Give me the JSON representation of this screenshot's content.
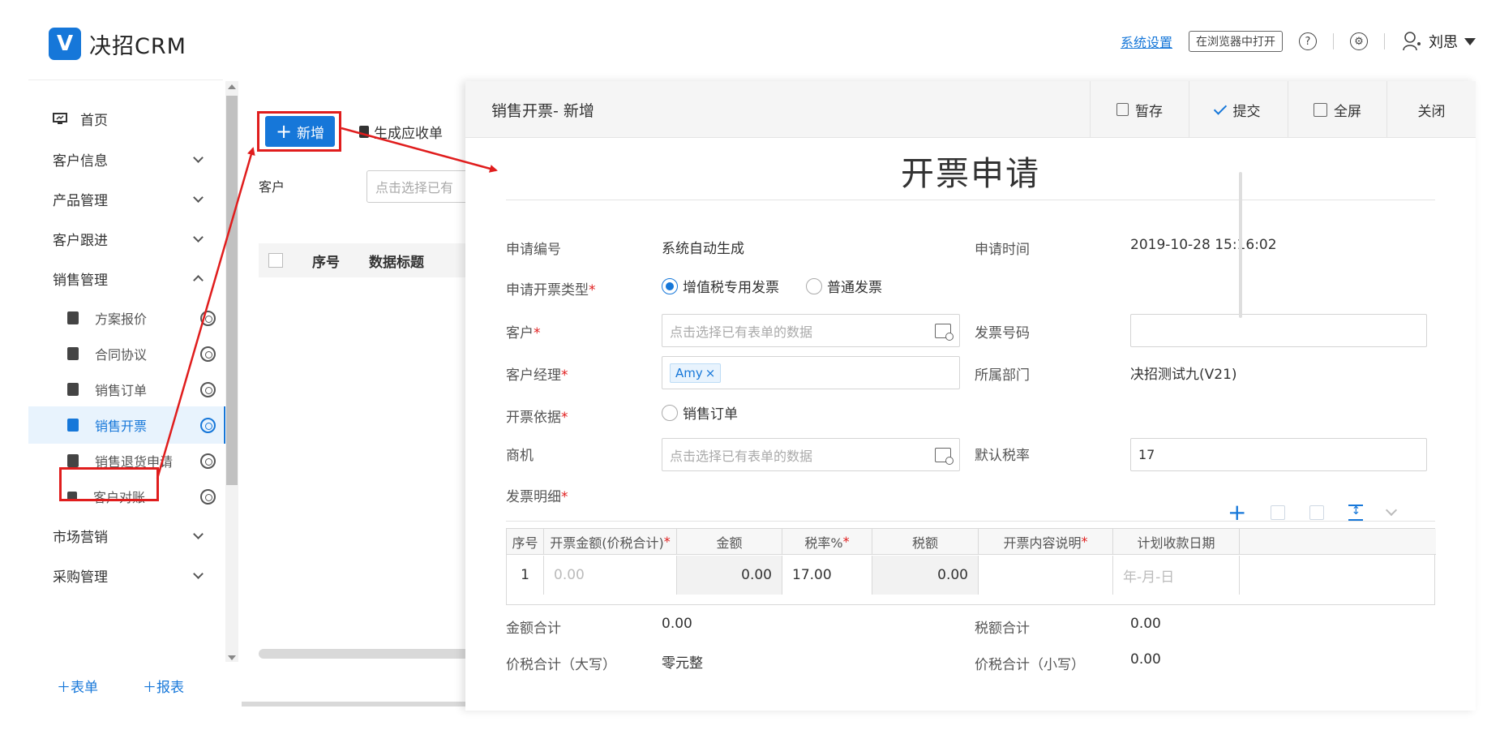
{
  "app": {
    "logo_text": "决招CRM",
    "logo_badge": "V",
    "accent": "#1677d9",
    "annotation_color": "#e01d1d"
  },
  "header": {
    "settings_link": "系统设置",
    "open_in_browser": "在浏览器中打开",
    "help_icon": "question-circle-icon",
    "settings_icon": "gear-icon",
    "user_name": "刘思"
  },
  "sidebar": {
    "items": [
      {
        "label": "首页",
        "icon": "home-icon"
      },
      {
        "label": "客户信息"
      },
      {
        "label": "产品管理"
      },
      {
        "label": "客户跟进"
      },
      {
        "label": "销售管理"
      }
    ],
    "sub_items": [
      {
        "label": "方案报价"
      },
      {
        "label": "合同协议"
      },
      {
        "label": "销售订单"
      },
      {
        "label": "销售开票"
      },
      {
        "label": "销售退货申请"
      },
      {
        "label": "客户对账"
      }
    ],
    "items_after": [
      {
        "label": "市场营销"
      },
      {
        "label": "采购管理"
      }
    ],
    "footer": {
      "add_form": "表单",
      "add_report": "报表"
    }
  },
  "list_page": {
    "add_button": "新增",
    "generate_button": "生成应收单",
    "customer_label": "客户",
    "customer_placeholder": "点击选择已有",
    "col_index": "序号",
    "col_title": "数据标题"
  },
  "modal": {
    "title": "销售开票- 新增",
    "actions": {
      "save_draft": "暂存",
      "submit": "提交",
      "fullscreen": "全屏",
      "close": "关闭"
    },
    "form_title": "开票申请",
    "fields": {
      "apply_no_label": "申请编号",
      "apply_no_value": "系统自动生成",
      "apply_time_label": "申请时间",
      "apply_time_value": "2019-10-28 15:16:02",
      "invoice_type_label": "申请开票类型",
      "invoice_type_options": [
        "增值税专用发票",
        "普通发票"
      ],
      "invoice_type_selected": "增值税专用发票",
      "customer_label": "客户",
      "customer_placeholder": "点击选择已有表单的数据",
      "invoice_no_label": "发票号码",
      "invoice_no_value": "",
      "manager_label": "客户经理",
      "manager_tag": "Amy",
      "department_label": "所属部门",
      "department_value": "决招测试九(V21)",
      "basis_label": "开票依据",
      "basis_option": "销售订单",
      "opportunity_label": "商机",
      "opportunity_placeholder": "点击选择已有表单的数据",
      "tax_rate_label": "默认税率",
      "tax_rate_value": "17"
    },
    "detail": {
      "label": "发票明细",
      "columns": [
        "序号",
        "开票金额(价税合计)",
        "金额",
        "税率%",
        "税额",
        "开票内容说明",
        "计划收款日期"
      ],
      "required_columns": [
        "开票金额(价税合计)",
        "税率%",
        "开票内容说明"
      ],
      "rows": [
        {
          "index": "1",
          "invoice_amount": "0.00",
          "amount": "0.00",
          "tax_rate": "17.00",
          "tax": "0.00",
          "description": "",
          "date": "年-月-日"
        }
      ]
    },
    "totals": {
      "amount_total_label": "金额合计",
      "amount_total_value": "0.00",
      "tax_total_label": "税额合计",
      "tax_total_value": "0.00",
      "grand_upper_label": "价税合计（大写）",
      "grand_upper_value": "零元整",
      "grand_lower_label": "价税合计（小写）",
      "grand_lower_value": "0.00"
    }
  }
}
